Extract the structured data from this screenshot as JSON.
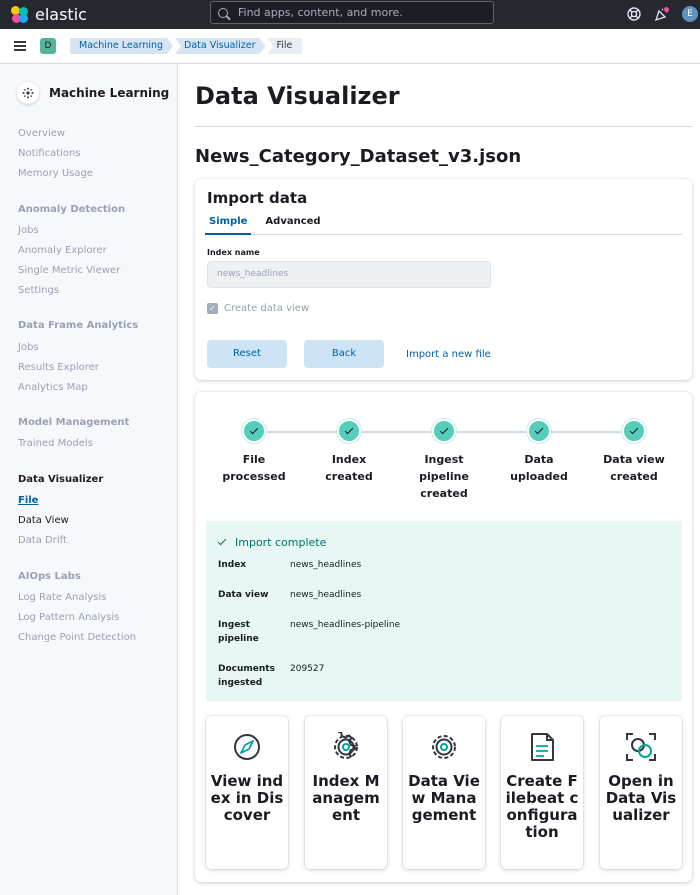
{
  "header": {
    "brand": "elastic",
    "search_placeholder": "Find apps, content, and more.",
    "avatar_initial": "E",
    "icons": [
      "help-icon",
      "news-icon",
      "user-avatar"
    ]
  },
  "breadcrumbs": {
    "space_badge": "D",
    "items": [
      "Machine Learning",
      "Data Visualizer",
      "File"
    ]
  },
  "sidebar": {
    "title": "Machine Learning",
    "items": {
      "overview": "Overview",
      "notifications": "Notifications",
      "memory_usage": "Memory Usage",
      "anomaly_detection": "Anomaly Detection",
      "ad_jobs": "Jobs",
      "anomaly_explorer": "Anomaly Explorer",
      "single_metric_viewer": "Single Metric Viewer",
      "ad_settings": "Settings",
      "data_frame_analytics": "Data Frame Analytics",
      "dfa_jobs": "Jobs",
      "results_explorer": "Results Explorer",
      "analytics_map": "Analytics Map",
      "model_management": "Model Management",
      "trained_models": "Trained Models",
      "data_visualizer": "Data Visualizer",
      "file": "File",
      "data_view": "Data View",
      "data_drift": "Data Drift",
      "aiops_labs": "AIOps Labs",
      "log_rate_analysis": "Log Rate Analysis",
      "log_pattern_analysis": "Log Pattern Analysis",
      "change_point_detection": "Change Point Detection"
    }
  },
  "main": {
    "page_title": "Data Visualizer",
    "file_name": "News_Category_Dataset_v3.json",
    "import_panel": {
      "title": "Import data",
      "tabs": [
        "Simple",
        "Advanced"
      ],
      "index_name_label": "Index name",
      "index_name_value": "news_headlines",
      "create_data_view_label": "Create data view",
      "reset_label": "Reset",
      "back_label": "Back",
      "import_new_file_label": "Import a new file"
    },
    "steps": [
      {
        "line1": "File",
        "line2": "processed",
        "line3": ""
      },
      {
        "line1": "Index",
        "line2": "created",
        "line3": ""
      },
      {
        "line1": "Ingest",
        "line2": "pipeline",
        "line3": "created"
      },
      {
        "line1": "Data",
        "line2": "uploaded",
        "line3": ""
      },
      {
        "line1": "Data view",
        "line2": "created",
        "line3": ""
      }
    ],
    "import_complete": {
      "title": "Import complete",
      "rows": [
        {
          "k1": "Index",
          "k2": "",
          "value": "news_headlines"
        },
        {
          "k1": "Data view",
          "k2": "",
          "value": "news_headlines"
        },
        {
          "k1": "Ingest",
          "k2": "pipeline",
          "value": "news_headlines-pipeline"
        },
        {
          "k1": "Documents",
          "k2": "ingested",
          "value": "209527"
        }
      ]
    },
    "cards": [
      {
        "title": "View index in Discover",
        "icon": "compass-icon"
      },
      {
        "title": "Index Management",
        "icon": "gear-icon"
      },
      {
        "title": "Data View Management",
        "icon": "gear-icon"
      },
      {
        "title": "Create Filebeat configuration",
        "icon": "document-icon"
      },
      {
        "title": "Open in Data Visualizer",
        "icon": "visualize-icon"
      }
    ]
  },
  "colors": {
    "accent": "#0061a6",
    "success": "#54cebb",
    "header_bg": "#25282f"
  }
}
